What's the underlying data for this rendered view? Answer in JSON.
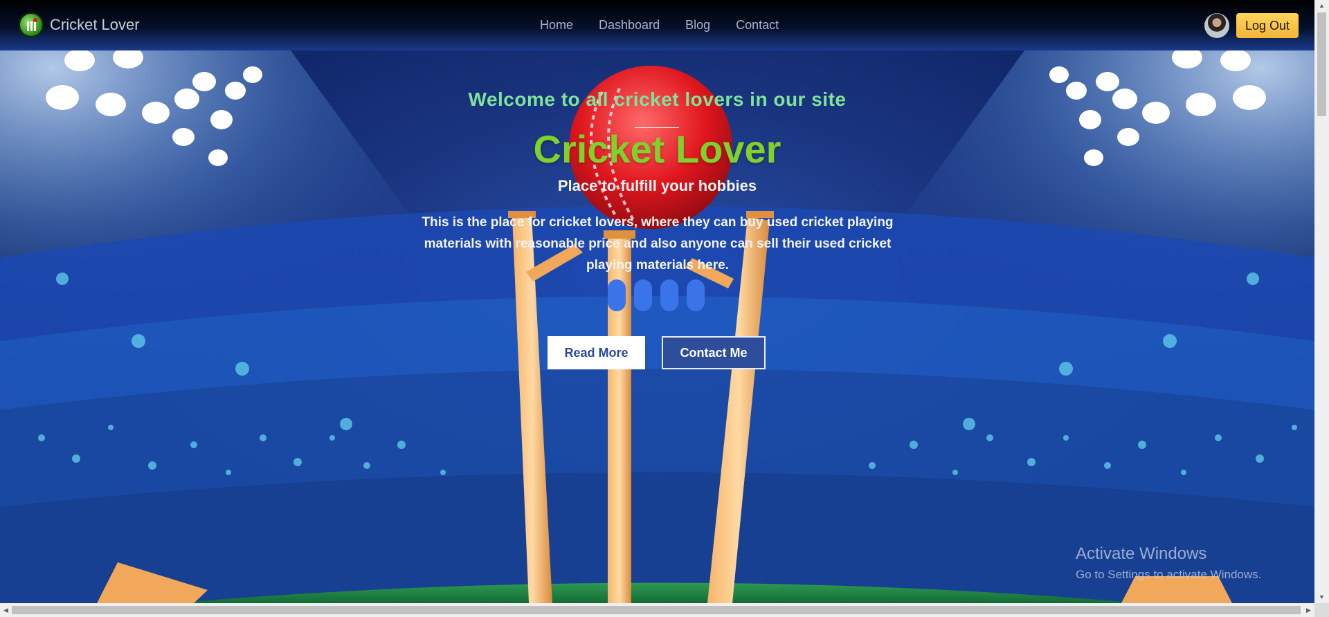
{
  "navbar": {
    "brand_name": "Cricket Lover",
    "links": [
      "Home",
      "Dashboard",
      "Blog",
      "Contact"
    ],
    "logout_label": "Log Out"
  },
  "hero": {
    "welcome": "Welcome to all cricket lovers in our site",
    "title": "Cricket Lover",
    "subtitle": "Place to fulfill your hobbies",
    "description": "This is the place for cricket lovers, where they can buy used cricket playing materials with reasonable price and also anyone can sell their used cricket playing materials here.",
    "read_more_label": "Read More",
    "contact_label": "Contact Me"
  },
  "watermark": {
    "title": "Activate Windows",
    "subtitle": "Go to Settings to activate Windows."
  },
  "colors": {
    "accent_green": "#7fd22a",
    "welcome_green": "#7fe39b",
    "logout_yellow": "#ffd55a",
    "contact_blue": "#2e4e9c",
    "loader_blue": "#3a74e8"
  },
  "icons": {
    "brand": "cricket-logo-icon",
    "avatar": "user-avatar"
  }
}
